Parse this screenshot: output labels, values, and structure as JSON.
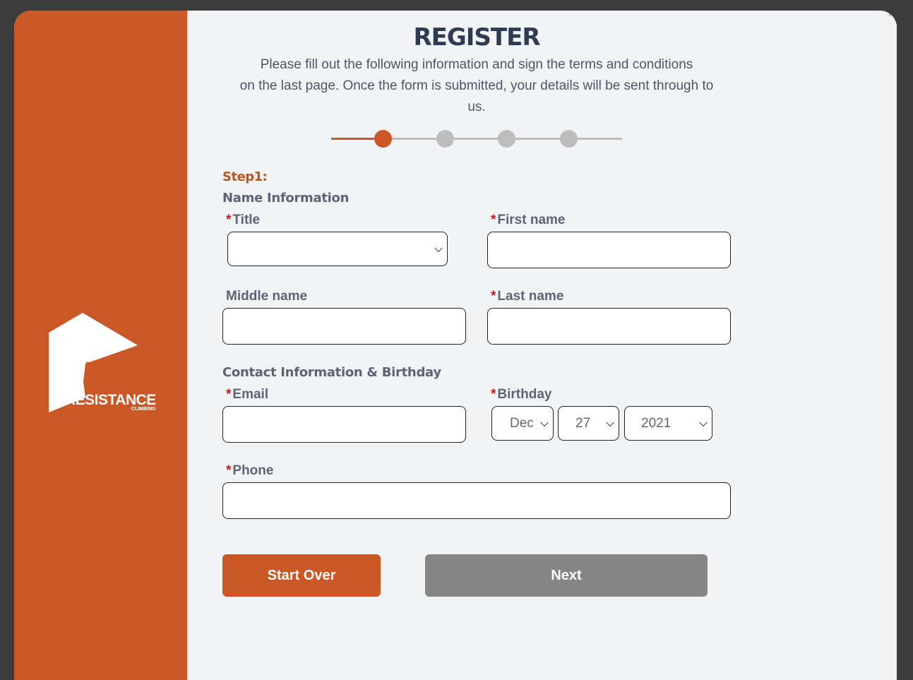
{
  "page": {
    "title": "REGISTER",
    "intro_lines": [
      "Please fill out the following information and sign the terms and conditions",
      "on the last page. Once the form is submitted, your details will be sent through to",
      "us."
    ]
  },
  "brand": {
    "name": "RESISTANCE",
    "sub": "CLIMBING",
    "color": "#cb5726"
  },
  "stepper": {
    "total_steps": 4,
    "current_step": 1
  },
  "form": {
    "step_label": "Step1:",
    "section_name": "Name Information",
    "section_contact": "Contact Information & Birthday",
    "required_marker": "*",
    "fields": {
      "title": {
        "label": "Title",
        "value": ""
      },
      "first_name": {
        "label": "First name",
        "value": ""
      },
      "middle_name": {
        "label": "Middle name",
        "value": ""
      },
      "last_name": {
        "label": "Last name",
        "value": ""
      },
      "email": {
        "label": "Email",
        "value": ""
      },
      "birthday": {
        "label": "Birthday",
        "month": "Dec",
        "day": "27",
        "year": "2021"
      },
      "phone": {
        "label": "Phone",
        "value": ""
      }
    }
  },
  "buttons": {
    "start_over": "Start Over",
    "next": "Next"
  }
}
